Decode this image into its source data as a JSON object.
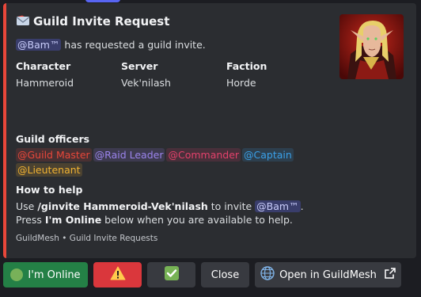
{
  "embed": {
    "title": "Guild Invite Request",
    "title_icon": "envelope-icon",
    "description_mention": "@Bam™",
    "description_rest": " has requested a guild invite.",
    "fields": [
      {
        "name": "Character",
        "value": "Hammeroid"
      },
      {
        "name": "Server",
        "value": "Vek'nilash"
      },
      {
        "name": "Faction",
        "value": "Horde"
      }
    ],
    "thumbnail_icon": "character-portrait",
    "officers_heading": "Guild officers",
    "roles": [
      {
        "label": "@Guild Master",
        "color": "#e8473a"
      },
      {
        "label": "@Raid Leader",
        "color": "#9b84ec"
      },
      {
        "label": "@Commander",
        "color": "#e3416b"
      },
      {
        "label": "@Captain",
        "color": "#3aa0e8"
      },
      {
        "label": "@Lieutenant",
        "color": "#f0b232"
      }
    ],
    "help_heading": "How to help",
    "help_line1_pre": "Use ",
    "help_command": "/ginvite Hammeroid-Vek'nilash",
    "help_line1_mid": " to invite ",
    "help_mention": "@Bam™",
    "help_line1_post": ".",
    "help_line2_pre": "Press ",
    "help_line2_bold": "I'm Online",
    "help_line2_post": " below when you are available to help.",
    "footer": "GuildMesh • Guild Invite Requests",
    "accent_color": "#e8473a"
  },
  "buttons": {
    "online_label": "I'm Online",
    "online_icon": "green-circle-icon",
    "warning_icon": "warning-icon",
    "check_icon": "check-icon",
    "close_label": "Close",
    "open_label": "Open in GuildMesh",
    "open_icon": "globe-icon",
    "external_icon": "external-link-icon"
  }
}
